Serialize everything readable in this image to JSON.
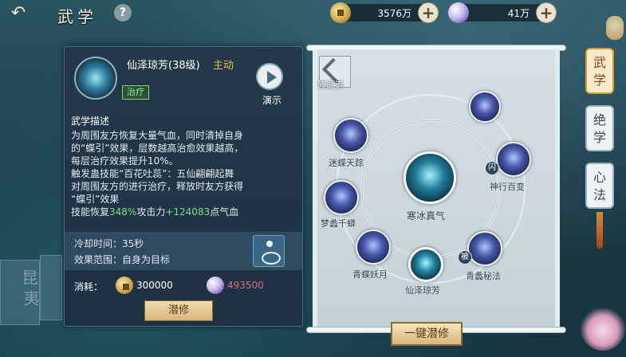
{
  "header": {
    "title": "武学",
    "back_icon": "back-arrow-icon",
    "help_label": "?",
    "coins": {
      "icon": "coin-icon",
      "value": "3576万",
      "plus": "+"
    },
    "pearls": {
      "icon": "pearl-icon",
      "value": "41万",
      "plus": "+"
    }
  },
  "skill": {
    "name": "仙泽琼芳(38级)",
    "type": "主动",
    "tag": "治疗",
    "demo_label": "演示",
    "desc_heading": "武学描述",
    "desc_lines": [
      "为周围友方恢复大量气血，同时清掉自身",
      "的“蝶引”效果，层数越高治愈效果越高，",
      "每层治疗效果提升10%。",
      "触发蛊技能“百花吐蕊”：五仙翩翩起舞",
      "对周围友方的进行治疗，释放时友方获得",
      "“蝶引”效果"
    ],
    "restore_prefix": "技能恢复",
    "restore_pct": "348%",
    "restore_mid": "攻击力",
    "restore_flat": "+124083",
    "restore_suffix": "点气血",
    "cooldown": "冷却时间：35秒",
    "range": "效果范围：自身为目标",
    "cost_label": "消耗：",
    "cost_coins": "300000",
    "cost_pearls": "493500",
    "train_label": "潜修"
  },
  "side_card_glyphs": [
    "昆",
    "夷"
  ],
  "tree": {
    "back_label": "修武谱",
    "core_label": "寒冰真气",
    "nodes": [
      {
        "label": "迷蝶天踪"
      },
      {
        "label": "梦蠡千蟒"
      },
      {
        "label": "青蝶妖月"
      },
      {
        "label": "仙泽琼芳"
      },
      {
        "label": "青蠡秘法"
      },
      {
        "label": "神行百变"
      },
      {
        "label": ""
      }
    ],
    "badge_flash": "闪",
    "badge_passive": "被",
    "one_key_label": "一键潜修"
  },
  "tabs": [
    {
      "label": "武\n学",
      "active": true
    },
    {
      "label": "绝\n学",
      "active": false
    },
    {
      "label": "心\n法",
      "active": false
    }
  ],
  "colors": {
    "heal_green": "#79e07a",
    "accent_gold": "#e6b84a",
    "pearl_cost": "#d46a8a"
  }
}
